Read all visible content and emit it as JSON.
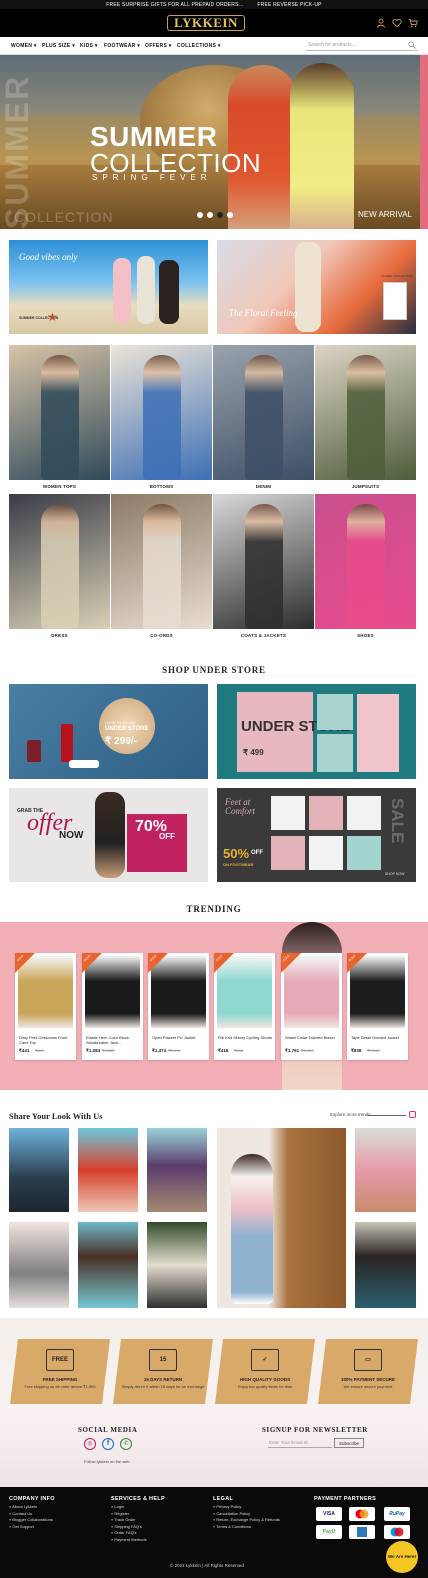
{
  "topbar": {
    "msg1": "FREE SURPRISE GIFTS FOR ALL PREPAID ORDERS...",
    "msg2": "FREE REVERSE PICK-UP"
  },
  "header": {
    "logo": "LYKKEIN",
    "icons": [
      "user-icon",
      "heart-icon",
      "cart-icon"
    ]
  },
  "nav": {
    "items": [
      "WOMEN ▾",
      "PLUS SIZE ▾",
      "KIDS ▾",
      "FOOTWEAR ▾",
      "OFFERS ▾",
      "COLLECTIONS ▾"
    ],
    "search_placeholder": "Search for products..."
  },
  "hero": {
    "line1": "SUMMER",
    "line2": "COLLECTION",
    "line3": "SPRING FEVER",
    "watermark_vertical": "SUMMER",
    "watermark_small": "COLLECTION",
    "corner": "NEW ARRIVAL",
    "slides": 4,
    "active_slide": 3
  },
  "banners": {
    "left_text": "Good vibes only",
    "left_sub": "SUMMER COLLECTION",
    "right_text": "The Floral Feeling",
    "right_sub": "FLORAL COLLECTION"
  },
  "categories": [
    {
      "label": "WOMEN TOPS",
      "c1": "#2f4a5a",
      "c2": "#d8c3a8"
    },
    {
      "label": "BOTTOMS",
      "c1": "#3d6fb5",
      "c2": "#ece4d8"
    },
    {
      "label": "DENIM",
      "c1": "#3d4f66",
      "c2": "#9aa3ad"
    },
    {
      "label": "JUMPSUITS",
      "c1": "#4e5d3a",
      "c2": "#ddd4c6"
    },
    {
      "label": "DRESS",
      "c1": "#d9d0b5",
      "c2": "#3a3d48"
    },
    {
      "label": "CO-ORDS",
      "c1": "#e7ddd0",
      "c2": "#8d7a66"
    },
    {
      "label": "COATS & JACKETS",
      "c1": "#2d2d2d",
      "c2": "#d8d8d8"
    },
    {
      "label": "SHOES",
      "c1": "#e84c8b",
      "c2": "#c84f8e"
    }
  ],
  "store": {
    "title": "SHOP UNDER STORE",
    "b1_tag": "UNDER STORE",
    "b1_price": "₹ 299/-",
    "b1_small": "LOOK IN STORE",
    "b2_title": "UNDER STORE",
    "b2_price": "₹ 499",
    "b3_grab": "GRAB THE",
    "b3_offer": "offer",
    "b3_now": "NOW",
    "b3_pct": "70%",
    "b3_off": "OFF",
    "b4_feet": "Feet at Comfort",
    "b4_pct": "50%",
    "b4_off": "OFF",
    "b4_on": "ON FOOTWEAR",
    "b4_sale": "SALE",
    "b4_shop": "SHOP NOW"
  },
  "trending": {
    "title": "TRENDING",
    "badge": "SOLD",
    "products": [
      {
        "name": "Ditsy Print Crisscross Front Cami Top",
        "price": "₹441",
        "old": "₹899",
        "color": "#caa65a"
      },
      {
        "name": "Elastic Hem Color Block Windbreaker Jack...",
        "price": "₹1,084",
        "old": "₹1,850",
        "color": "#1a1a1a"
      },
      {
        "name": "Open Placket PU Jacket",
        "price": "₹1,374",
        "old": "₹2,499",
        "color": "#1b1b1b"
      },
      {
        "name": "Rib Knit Skinny Cycling Shorts",
        "price": "₹416",
        "old": "₹630",
        "color": "#8fd8cf"
      },
      {
        "name": "Shawl Collar Tailored Blazer",
        "price": "₹1,761",
        "old": "₹2,650",
        "color": "#e7a9b8"
      },
      {
        "name": "Tape Detail Hooded Jacket",
        "price": "₹838",
        "old": "₹1,599",
        "color": "#1d1d1d"
      }
    ]
  },
  "share": {
    "title": "Share Your Look With Us",
    "explore": "Explore more trends"
  },
  "features": [
    {
      "title": "FREE SHIPPING",
      "desc": "Free shipping on all order above ₹1,999",
      "icon": "FREE"
    },
    {
      "title": "15 DAYS RETURN",
      "desc": "Simply return it within 15 days for an exchange",
      "icon": "15"
    },
    {
      "title": "HIGH QUALITY GOODS",
      "desc": "Enjoy top quality items for less",
      "icon": "✓"
    },
    {
      "title": "100% PAYMENT SECURE",
      "desc": "We ensure secure payment",
      "icon": "▭"
    }
  ],
  "social": {
    "title": "SOCIAL MEDIA",
    "follow": "Follow lykkein on the web"
  },
  "newsletter": {
    "title": "SIGNUP FOR NEWSLETTER",
    "placeholder": "Enter Your Email Id...",
    "button": "Subscribe"
  },
  "footer": {
    "col1": {
      "title": "COMPANY INFO",
      "links": [
        "» About Lykkein",
        "» Contact Us",
        "» Blogger Collaborations",
        "» Get Support"
      ]
    },
    "col2": {
      "title": "SERVICES & HELP",
      "links": [
        "» Login",
        "» Register",
        "» Track Order",
        "» Shipping FAQ's",
        "» Order FAQ's",
        "» Payment Methods"
      ]
    },
    "col3": {
      "title": "LEGAL",
      "links": [
        "» Privacy Policy",
        "» Cancellation Policy",
        "» Return, Exchange Policy & Refunds",
        "» Terms & Conditions"
      ]
    },
    "col4": {
      "title": "PAYMENT PARTNERS",
      "partners": [
        "VISA",
        "",
        "RuPay",
        "PayU",
        "",
        ""
      ]
    },
    "copyright": "© 2021 Lykkein | All Rights Reserved",
    "chat": "We Are Here!"
  }
}
